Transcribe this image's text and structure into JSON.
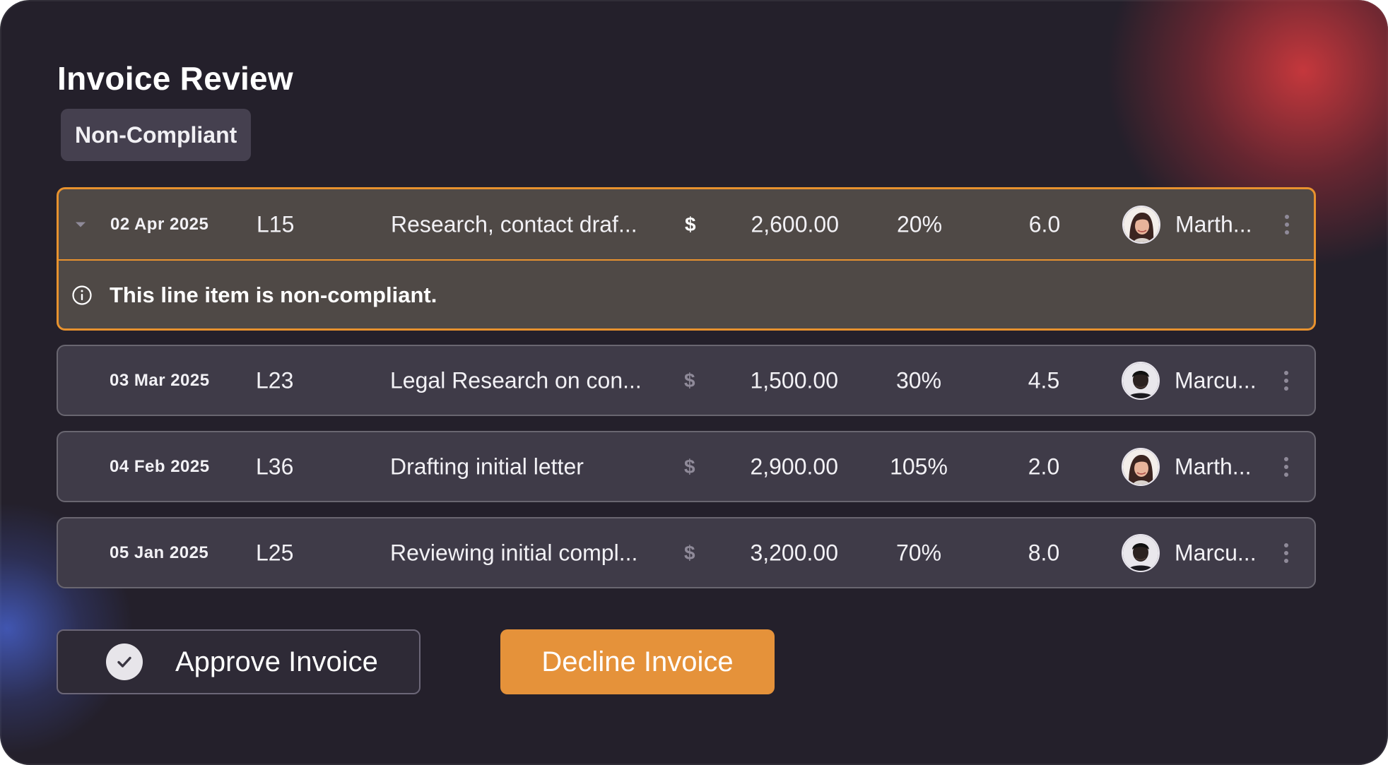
{
  "title": "Invoice Review",
  "badge": "Non-Compliant",
  "alert_message": "This line item is non-compliant.",
  "currency_symbol": "$",
  "rows": [
    {
      "date": "02 Apr 2025",
      "code": "L15",
      "description": "Research, contact draf...",
      "amount": "2,600.00",
      "percent": "20%",
      "hours": "6.0",
      "person": "Marth...",
      "avatar": "woman-avatar",
      "flagged": true
    },
    {
      "date": "03 Mar 2025",
      "code": "L23",
      "description": "Legal Research on con...",
      "amount": "1,500.00",
      "percent": "30%",
      "hours": "4.5",
      "person": "Marcu...",
      "avatar": "man-avatar",
      "flagged": false
    },
    {
      "date": "04 Feb 2025",
      "code": "L36",
      "description": "Drafting initial letter",
      "amount": "2,900.00",
      "percent": "105%",
      "hours": "2.0",
      "person": "Marth...",
      "avatar": "woman-avatar",
      "flagged": false
    },
    {
      "date": "05 Jan 2025",
      "code": "L25",
      "description": "Reviewing initial compl...",
      "amount": "3,200.00",
      "percent": "70%",
      "hours": "8.0",
      "person": "Marcu...",
      "avatar": "man-avatar",
      "flagged": false
    }
  ],
  "actions": {
    "approve": "Approve Invoice",
    "decline": "Decline Invoice"
  },
  "colors": {
    "background": "#24202b",
    "accent": "#e5923a",
    "row": "#3f3b48",
    "alert_row": "#4f4946"
  },
  "icons": {
    "expand": "chevron-down-icon",
    "info": "info-icon",
    "approve": "check-circle-icon",
    "menu": "more-vertical-icon"
  }
}
